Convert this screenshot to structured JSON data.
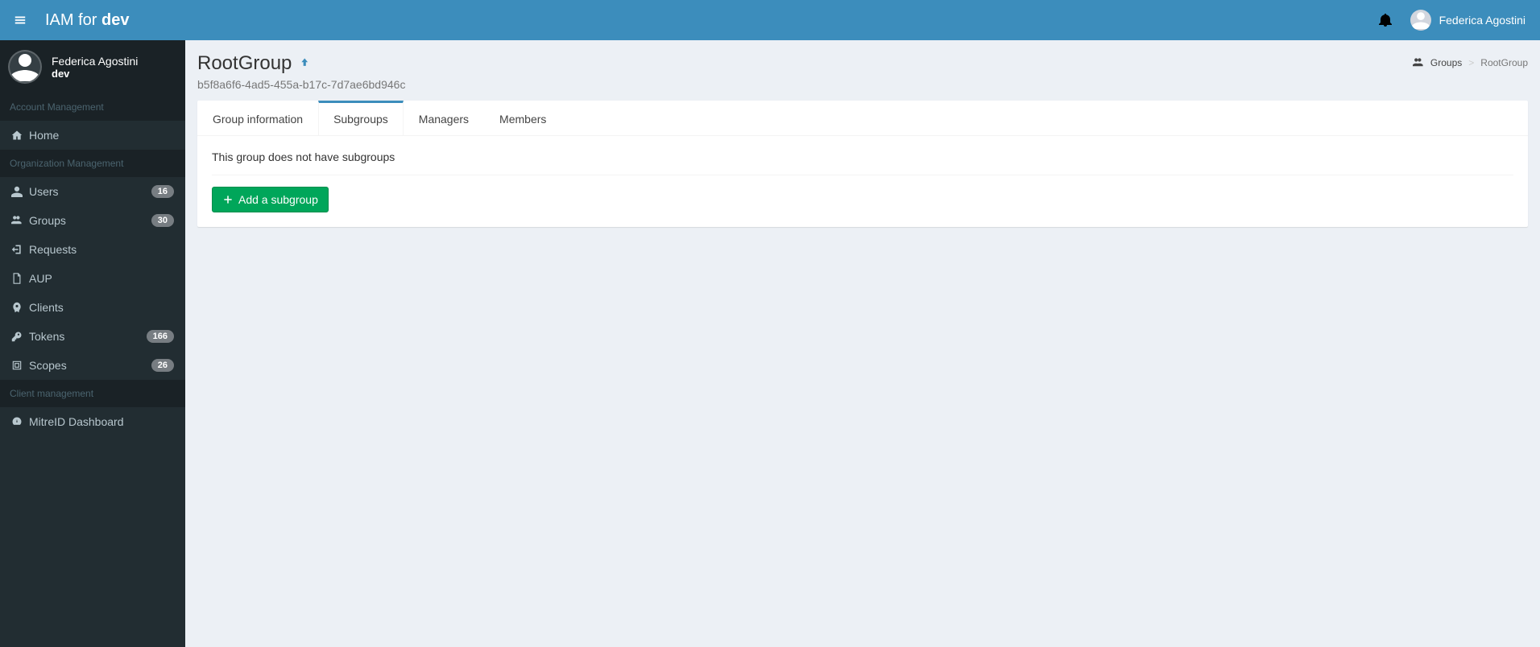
{
  "header": {
    "logo_prefix": "IAM for ",
    "logo_bold": "dev",
    "username": "Federica Agostini"
  },
  "sidebar": {
    "user": {
      "name": "Federica Agostini",
      "role": "dev"
    },
    "sections": {
      "account": "Account Management",
      "org": "Organization Management",
      "client": "Client management"
    },
    "items": {
      "home": {
        "label": "Home"
      },
      "users": {
        "label": "Users",
        "badge": "16"
      },
      "groups": {
        "label": "Groups",
        "badge": "30"
      },
      "requests": {
        "label": "Requests"
      },
      "aup": {
        "label": "AUP"
      },
      "clients": {
        "label": "Clients"
      },
      "tokens": {
        "label": "Tokens",
        "badge": "166"
      },
      "scopes": {
        "label": "Scopes",
        "badge": "26"
      },
      "mitreid": {
        "label": "MitreID Dashboard"
      }
    }
  },
  "breadcrumb": {
    "groups": "Groups",
    "current": "RootGroup"
  },
  "page": {
    "title": "RootGroup",
    "uuid": "b5f8a6f6-4ad5-455a-b17c-7d7ae6bd946c"
  },
  "tabs": {
    "info": "Group information",
    "subgroups": "Subgroups",
    "managers": "Managers",
    "members": "Members"
  },
  "content": {
    "empty": "This group does not have subgroups",
    "add_btn": "Add a subgroup"
  }
}
